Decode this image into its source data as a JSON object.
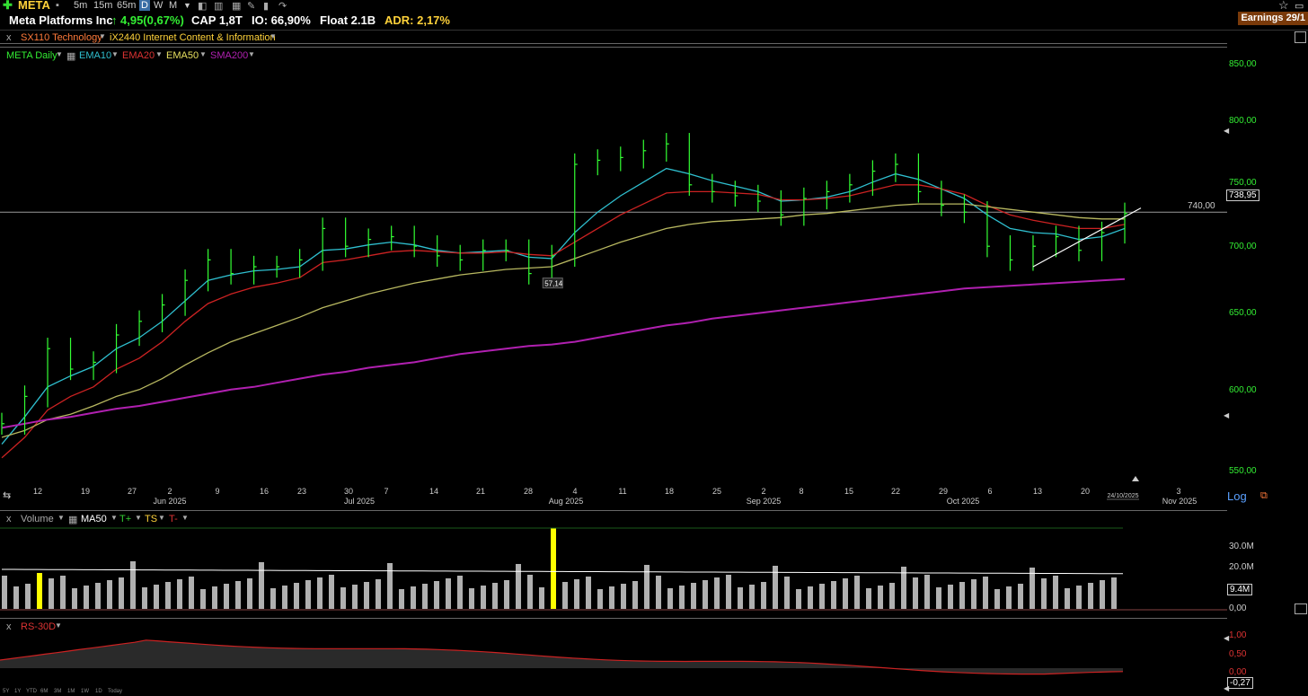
{
  "header": {
    "ticker": "META",
    "timeframes": [
      "5m",
      "15m",
      "65m",
      "D",
      "W",
      "M"
    ],
    "active_timeframe": "D"
  },
  "info": {
    "company": "Meta Platforms Inc",
    "change": "4,95(0,67%)",
    "cap": "CAP 1,8T",
    "io": "IO: 66,90%",
    "float": "Float 2.1B",
    "adr": "ADR: 2,17%"
  },
  "earnings_badge": "Earnings 29/1",
  "sector": {
    "close": "x",
    "sector_label": "SX110 Technology",
    "industry_label": "iX2440 Internet Content & Information"
  },
  "legend": {
    "main": "META Daily",
    "ema10": "EMA10",
    "ema20": "EMA20",
    "ema50": "EMA50",
    "sma200": "SMA200"
  },
  "price_axis": {
    "ticks": [
      "850,00",
      "800,00",
      "750,00",
      "700,00",
      "650,00",
      "600,00",
      "550,00"
    ],
    "level_label": "740,00",
    "last_price": "738,95",
    "log_label": "Log"
  },
  "date_axis": {
    "day_labels": [
      "12",
      "19",
      "27",
      "2",
      "9",
      "16",
      "23",
      "30",
      "7",
      "14",
      "21",
      "28",
      "4",
      "11",
      "18",
      "25",
      "2",
      "8",
      "15",
      "22",
      "29",
      "6",
      "13",
      "20",
      "3"
    ],
    "month_labels": [
      "Jun 2025",
      "Jul 2025",
      "Aug 2025",
      "Sep 2025",
      "Oct 2025",
      "Nov 2025"
    ],
    "current_date": "24/10/2025"
  },
  "low_annotation": "57,14",
  "volume_panel": {
    "close": "x",
    "label": "Volume",
    "ma": "MA50",
    "t_plus": "T+",
    "ts": "TS",
    "t_minus": "T-",
    "ticks": [
      "30.0M",
      "20.0M",
      "10.0M",
      "0,00"
    ],
    "last_volume": "9.4M"
  },
  "rs_panel": {
    "close": "x",
    "label": "RS-30D",
    "ticks": [
      "1,00",
      "0,50",
      "0,00"
    ],
    "last_value": "-0,27",
    "ranges": [
      "5Y",
      "1Y",
      "YTD",
      "6M",
      "3M",
      "1M",
      "1W",
      "1D",
      "Today"
    ]
  },
  "colors": {
    "bars": "#33ff33",
    "ema10": "#2fbfcf",
    "ema20": "#cc2222",
    "ema50": "#b8b860",
    "sma200": "#b020b0",
    "rs_line": "#cc2222",
    "volume_highlight": "#ffff00"
  },
  "chart_data": {
    "type": "line",
    "title": "META Daily",
    "ylim": [
      550,
      850
    ],
    "x": [
      "2025-05-09",
      "2025-05-12",
      "2025-05-16",
      "2025-05-19",
      "2025-05-23",
      "2025-05-27",
      "2025-05-30",
      "2025-06-02",
      "2025-06-06",
      "2025-06-09",
      "2025-06-13",
      "2025-06-16",
      "2025-06-20",
      "2025-06-23",
      "2025-06-27",
      "2025-06-30",
      "2025-07-03",
      "2025-07-07",
      "2025-07-11",
      "2025-07-14",
      "2025-07-18",
      "2025-07-21",
      "2025-07-25",
      "2025-07-28",
      "2025-07-30",
      "2025-07-31",
      "2025-08-04",
      "2025-08-08",
      "2025-08-11",
      "2025-08-15",
      "2025-08-18",
      "2025-08-22",
      "2025-08-25",
      "2025-08-29",
      "2025-09-02",
      "2025-09-05",
      "2025-09-08",
      "2025-09-12",
      "2025-09-15",
      "2025-09-19",
      "2025-09-22",
      "2025-09-26",
      "2025-09-29",
      "2025-10-03",
      "2025-10-06",
      "2025-10-10",
      "2025-10-13",
      "2025-10-17",
      "2025-10-20",
      "2025-10-24"
    ],
    "series": [
      {
        "name": "META Daily",
        "values": [
          585,
          605,
          640,
          625,
          630,
          650,
          660,
          672,
          690,
          705,
          695,
          700,
          700,
          705,
          728,
          715,
          720,
          722,
          715,
          708,
          705,
          712,
          712,
          695,
          708,
          775,
          778,
          780,
          785,
          790,
          760,
          755,
          752,
          748,
          738,
          750,
          755,
          760,
          770,
          775,
          755,
          745,
          740,
          715,
          705,
          715,
          722,
          712,
          725,
          738.95
        ]
      },
      {
        "name": "EMA10",
        "values": [
          570,
          590,
          612,
          620,
          627,
          640,
          648,
          660,
          675,
          690,
          694,
          697,
          698,
          700,
          712,
          713,
          716,
          718,
          716,
          712,
          710,
          711,
          712,
          707,
          706,
          725,
          740,
          752,
          762,
          772,
          768,
          763,
          759,
          755,
          748,
          749,
          751,
          755,
          762,
          768,
          764,
          757,
          750,
          738,
          728,
          725,
          724,
          720,
          722,
          728
        ]
      },
      {
        "name": "EMA20",
        "values": [
          560,
          575,
          595,
          605,
          612,
          625,
          633,
          645,
          660,
          673,
          680,
          685,
          688,
          692,
          703,
          705,
          708,
          711,
          712,
          711,
          710,
          710,
          711,
          709,
          708,
          718,
          728,
          738,
          746,
          754,
          755,
          755,
          754,
          753,
          749,
          749,
          750,
          752,
          756,
          760,
          760,
          757,
          753,
          745,
          738,
          734,
          731,
          728,
          728,
          731
        ]
      },
      {
        "name": "EMA50",
        "values": [
          575,
          580,
          588,
          592,
          598,
          605,
          610,
          618,
          628,
          637,
          645,
          651,
          657,
          663,
          670,
          675,
          680,
          684,
          688,
          691,
          694,
          696,
          698,
          699,
          700,
          706,
          712,
          718,
          723,
          728,
          731,
          733,
          734,
          735,
          736,
          738,
          739,
          741,
          743,
          745,
          746,
          746,
          746,
          744,
          742,
          740,
          738,
          736,
          735,
          735
        ]
      },
      {
        "name": "SMA200",
        "values": [
          582,
          585,
          588,
          590,
          593,
          596,
          598,
          601,
          604,
          607,
          610,
          612,
          615,
          618,
          621,
          623,
          626,
          628,
          630,
          633,
          636,
          638,
          640,
          642,
          643,
          645,
          648,
          651,
          654,
          657,
          659,
          662,
          664,
          666,
          668,
          670,
          672,
          674,
          676,
          678,
          680,
          682,
          684,
          685,
          686,
          687,
          688,
          689,
          690,
          691
        ]
      }
    ],
    "annotations": [
      {
        "x": "2025-07-30",
        "label": "57,14"
      },
      {
        "y": 740,
        "label": "740,00"
      }
    ]
  }
}
